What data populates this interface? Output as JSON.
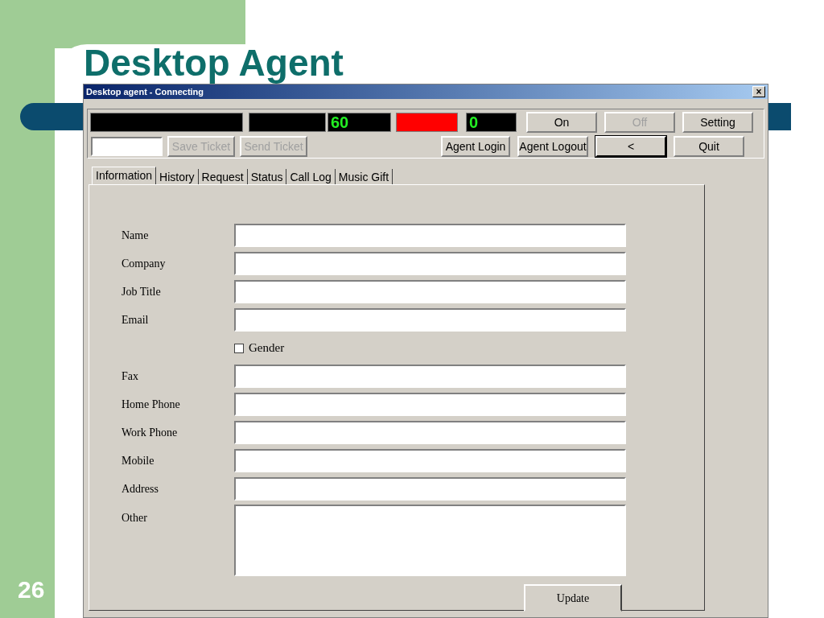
{
  "slide": {
    "title": "Desktop Agent",
    "page_number": "26"
  },
  "window": {
    "title": "Desktop agent - Connecting",
    "close": "×"
  },
  "displays": [
    {
      "color": "#000000"
    },
    {
      "color": "#000000"
    },
    {
      "value": "60",
      "color": "#000000"
    },
    {
      "color": "#ff0000"
    },
    {
      "value": "0",
      "color": "#000000"
    }
  ],
  "top_buttons": [
    {
      "label": "On",
      "disabled": false,
      "focused": false
    },
    {
      "label": "Off",
      "disabled": true,
      "focused": false
    },
    {
      "label": "Setting",
      "disabled": false,
      "focused": false
    }
  ],
  "ticket_buttons": [
    {
      "label": "Save Ticket",
      "disabled": true
    },
    {
      "label": "Send Ticket",
      "disabled": true
    }
  ],
  "bottom_buttons": [
    {
      "label": "Agent Login",
      "disabled": false,
      "focused": false
    },
    {
      "label": "Agent Logout",
      "disabled": false,
      "focused": false
    },
    {
      "label": "<",
      "disabled": false,
      "focused": true
    },
    {
      "label": "Quit",
      "disabled": false,
      "focused": false
    }
  ],
  "tabs": [
    {
      "label": "Information",
      "selected": true
    },
    {
      "label": "History",
      "selected": false
    },
    {
      "label": "Request",
      "selected": false
    },
    {
      "label": "Status",
      "selected": false
    },
    {
      "label": "Call Log",
      "selected": false
    },
    {
      "label": "Music Gift",
      "selected": false
    }
  ],
  "form": [
    {
      "kind": "text",
      "label": "Name"
    },
    {
      "kind": "text",
      "label": "Company"
    },
    {
      "kind": "text",
      "label": "Job Title"
    },
    {
      "kind": "text",
      "label": "Email"
    },
    {
      "kind": "checkbox",
      "label": "Gender",
      "checked": false
    },
    {
      "kind": "text",
      "label": "Fax"
    },
    {
      "kind": "text",
      "label": "Home Phone"
    },
    {
      "kind": "text",
      "label": "Work Phone"
    },
    {
      "kind": "text",
      "label": "Mobile"
    },
    {
      "kind": "text",
      "label": "Address"
    },
    {
      "kind": "textarea",
      "label": "Other"
    }
  ],
  "update_button": "Update"
}
